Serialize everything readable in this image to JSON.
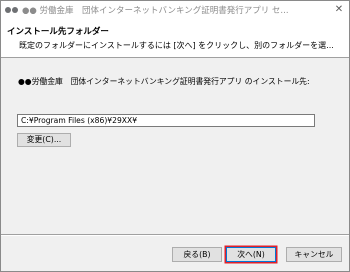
{
  "window": {
    "title": "●● 労働金庫　団体インターネットバンキング証明書発行アプリ セ...",
    "close_glyph": "✕"
  },
  "header": {
    "title": "インストール先フォルダー",
    "description": "既定のフォルダーにインストールするには [次へ] をクリックし、別のフォルダーを選..."
  },
  "main": {
    "instruction": "●●労働金庫　団体インターネットバンキング証明書発行アプリ のインストール先:",
    "install_path": "C:¥Program Files (x86)¥29XX¥",
    "change_button": "変更(C)..."
  },
  "footer": {
    "back_button": "戻る(B)",
    "next_button": "次へ(N)",
    "cancel_button": "キャンセル"
  }
}
